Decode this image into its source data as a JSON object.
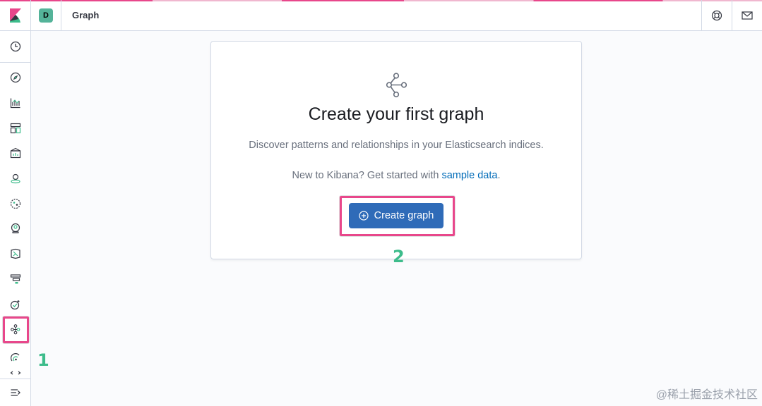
{
  "header": {
    "app_logo": "kibana-logo-icon",
    "space_initial": "D",
    "breadcrumb": "Graph",
    "help_icon": "help-icon",
    "newsfeed_icon": "mail-icon",
    "stripe_colors": [
      "#e8478b",
      "#f0b7cf"
    ]
  },
  "sidenav": {
    "items": [
      {
        "icon": "clock-icon",
        "label": "Recently viewed"
      },
      {
        "icon": "compass-icon",
        "label": "Discover"
      },
      {
        "icon": "visualize-icon",
        "label": "Visualize"
      },
      {
        "icon": "dashboard-icon",
        "label": "Dashboard"
      },
      {
        "icon": "canvas-icon",
        "label": "Canvas"
      },
      {
        "icon": "maps-icon",
        "label": "Maps"
      },
      {
        "icon": "ml-icon",
        "label": "Machine Learning"
      },
      {
        "icon": "siem-icon",
        "label": "SIEM"
      },
      {
        "icon": "logs-icon",
        "label": "Logs"
      },
      {
        "icon": "apm-icon",
        "label": "APM"
      },
      {
        "icon": "uptime-icon",
        "label": "Uptime"
      },
      {
        "icon": "graph-icon",
        "label": "Graph",
        "active": true
      },
      {
        "icon": "monitoring-icon",
        "label": "Monitoring"
      },
      {
        "icon": "dev-tools-icon",
        "label": "Dev Tools"
      }
    ],
    "collapse_icon": "menu-collapse-icon"
  },
  "empty_prompt": {
    "icon": "graph-app-icon",
    "title": "Create your first graph",
    "description": "Discover patterns and relationships in your Elasticsearch indices.",
    "hint_prefix": "New to Kibana? Get started with ",
    "hint_link": "sample data",
    "hint_suffix": ".",
    "button_label": "Create graph",
    "button_icon": "plus-in-circle-icon",
    "button_color": "#2f6bb8"
  },
  "annotations": {
    "marker_1": "1",
    "marker_2": "2",
    "highlight_color": "#e8478b",
    "marker_color": "#3dbc8b"
  },
  "watermark": "@稀土掘金技术社区"
}
